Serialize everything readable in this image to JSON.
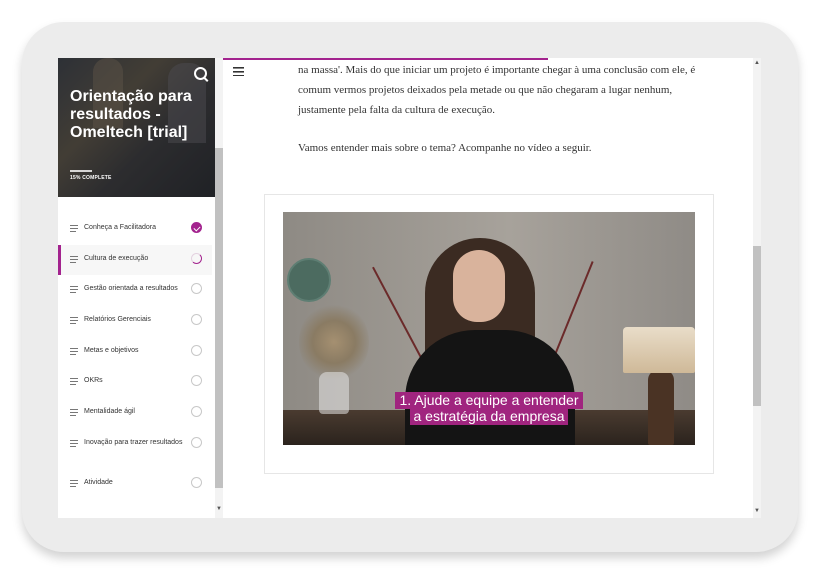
{
  "sidebar": {
    "course_title": "Orientação para resultados - Omeltech [trial]",
    "progress_label": "15% COMPLETE",
    "progress_percent": 15,
    "lessons": [
      {
        "label": "Conheça a Facilitadora",
        "status": "complete"
      },
      {
        "label": "Cultura de execução",
        "status": "in-progress"
      },
      {
        "label": "Gestão orientada a resultados",
        "status": "not-started"
      },
      {
        "label": "Relatórios Gerenciais",
        "status": "not-started"
      },
      {
        "label": "Metas e objetivos",
        "status": "not-started"
      },
      {
        "label": "OKRs",
        "status": "not-started"
      },
      {
        "label": "Mentalidade ágil",
        "status": "not-started"
      },
      {
        "label": "Inovação para trazer resultados",
        "status": "not-started"
      },
      {
        "label": "Atividade",
        "status": "not-started"
      }
    ]
  },
  "content": {
    "paragraph1": "na massa'. Mais do que iniciar um projeto é importante chegar à uma conclusão com ele, é comum vermos projetos deixados pela metade ou que não chegaram a lugar nenhum, justamente pela falta da cultura de execução.",
    "paragraph2": "Vamos entender mais sobre o tema? Acompanhe no vídeo a seguir.",
    "video_caption_line1": "1. Ajude a equipe a entender",
    "video_caption_line2": "a estratégia da empresa"
  },
  "colors": {
    "accent": "#a3238e",
    "caption_bg": "#a0257f"
  },
  "icons": [
    "search-icon",
    "menu-icon",
    "lesson-list-icon",
    "check-icon",
    "progress-ring-icon"
  ]
}
